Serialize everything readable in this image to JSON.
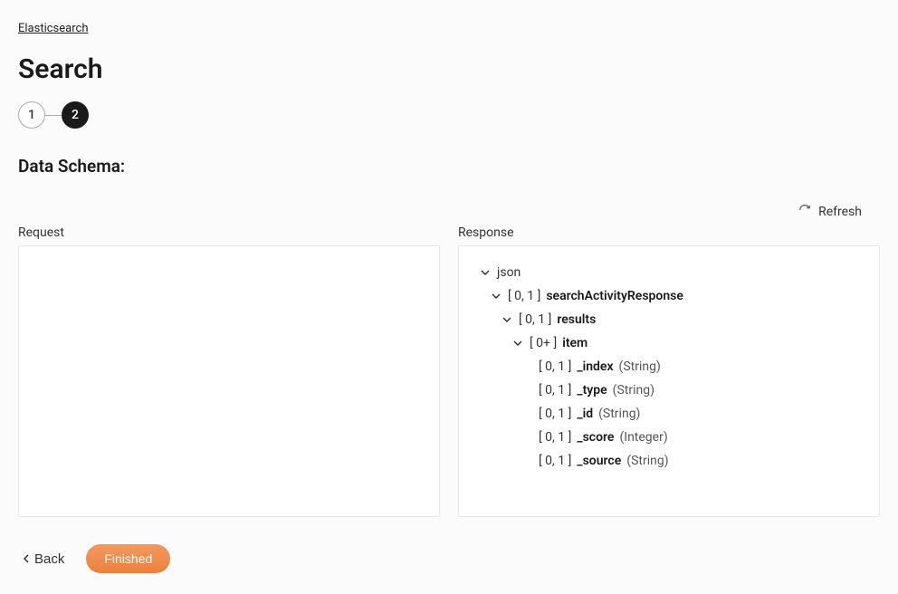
{
  "breadcrumb": "Elasticsearch",
  "title": "Search",
  "stepper": {
    "step1": "1",
    "step2": "2"
  },
  "section_title": "Data Schema:",
  "refresh_label": "Refresh",
  "panels": {
    "request_label": "Request",
    "response_label": "Response"
  },
  "tree": {
    "r0_key": "json",
    "r1_card": "[ 0, 1 ]",
    "r1_key": "searchActivityResponse",
    "r2_card": "[ 0, 1 ]",
    "r2_key": "results",
    "r3_card": "[ 0+ ]",
    "r3_key": "item",
    "r4_card": "[ 0, 1 ]",
    "r4_key": "_index",
    "r4_type": "(String)",
    "r5_card": "[ 0, 1 ]",
    "r5_key": "_type",
    "r5_type": "(String)",
    "r6_card": "[ 0, 1 ]",
    "r6_key": "_id",
    "r6_type": "(String)",
    "r7_card": "[ 0, 1 ]",
    "r7_key": "_score",
    "r7_type": "(Integer)",
    "r8_card": "[ 0, 1 ]",
    "r8_key": "_source",
    "r8_type": "(String)"
  },
  "footer": {
    "back": "Back",
    "finished": "Finished"
  }
}
